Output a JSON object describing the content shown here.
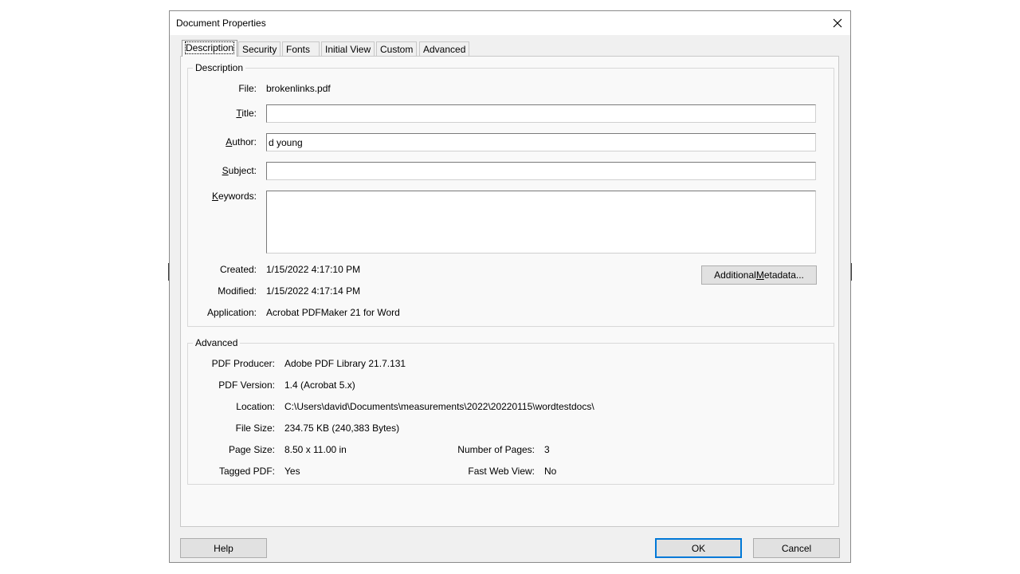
{
  "window": {
    "title": "Document Properties"
  },
  "tabs": [
    {
      "label": "Description",
      "active": true
    },
    {
      "label": "Security"
    },
    {
      "label": "Fonts"
    },
    {
      "label": "Initial View"
    },
    {
      "label": "Custom"
    },
    {
      "label": "Advanced"
    }
  ],
  "description_group": {
    "label": "Description",
    "file": {
      "label": "File:",
      "value": "brokenlinks.pdf"
    },
    "title": {
      "label_pre": "",
      "label_key": "T",
      "label_post": "itle:",
      "value": ""
    },
    "author": {
      "label_pre": "",
      "label_key": "A",
      "label_post": "uthor:",
      "value": "d young"
    },
    "subject": {
      "label_pre": "",
      "label_key": "S",
      "label_post": "ubject:",
      "value": ""
    },
    "keywords": {
      "label_pre": "",
      "label_key": "K",
      "label_post": "eywords:",
      "value": ""
    },
    "created": {
      "label": "Created:",
      "value": "1/15/2022 4:17:10 PM"
    },
    "modified": {
      "label": "Modified:",
      "value": "1/15/2022 4:17:14 PM"
    },
    "application": {
      "label": "Application:",
      "value": "Acrobat PDFMaker 21 for Word"
    },
    "additional_metadata_button": {
      "pre": "Additional ",
      "key": "M",
      "post": "etadata..."
    }
  },
  "advanced_group": {
    "label": "Advanced",
    "pdf_producer": {
      "label": "PDF Producer:",
      "value": "Adobe PDF Library 21.7.131"
    },
    "pdf_version": {
      "label": "PDF Version:",
      "value": "1.4 (Acrobat 5.x)"
    },
    "location": {
      "label": "Location:",
      "value": "C:\\Users\\david\\Documents\\measurements\\2022\\20220115\\wordtestdocs\\"
    },
    "file_size": {
      "label": "File Size:",
      "value": "234.75 KB (240,383 Bytes)"
    },
    "page_size": {
      "label": "Page Size:",
      "value": "8.50 x 11.00 in"
    },
    "number_of_pages": {
      "label": "Number of Pages:",
      "value": "3"
    },
    "tagged_pdf": {
      "label": "Tagged PDF:",
      "value": "Yes"
    },
    "fast_web_view": {
      "label": "Fast Web View:",
      "value": "No"
    }
  },
  "buttons": {
    "help": "Help",
    "ok": "OK",
    "cancel": "Cancel"
  },
  "colors": {
    "dialog_bg": "#f0f0f0",
    "panel_bg": "#f9f9f9",
    "focus_border": "#0078d7"
  },
  "icons": {
    "close": "close-icon"
  }
}
